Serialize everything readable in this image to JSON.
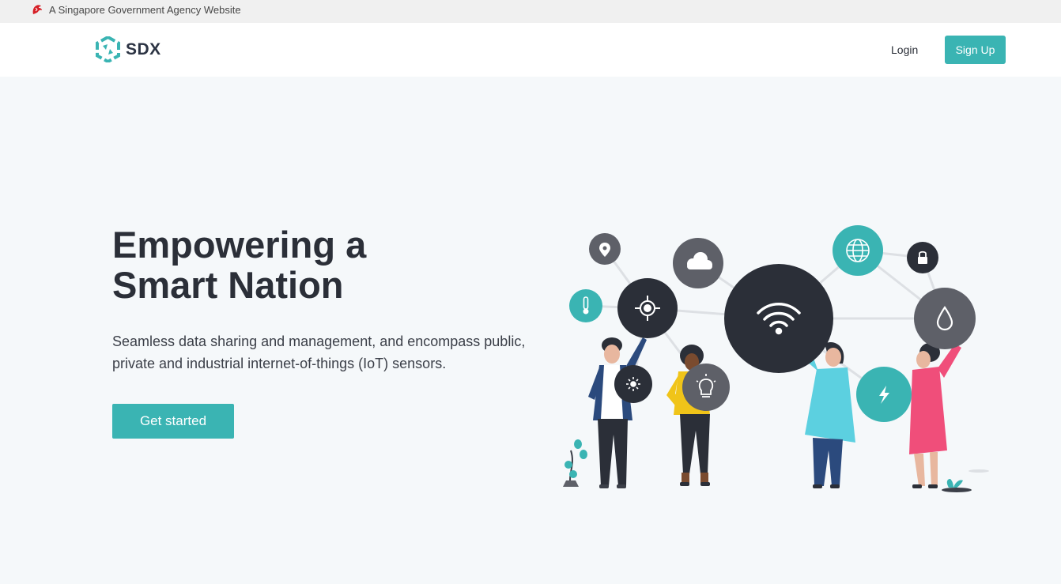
{
  "masthead": {
    "text": "A Singapore Government Agency Website",
    "icon": "lion-head-icon",
    "icon_color": "#d61f26"
  },
  "navbar": {
    "brand": "SDX",
    "login_label": "Login",
    "signup_label": "Sign Up"
  },
  "hero": {
    "title_line1": "Empowering a",
    "title_line2": "Smart Nation",
    "description": "Seamless data sharing and management, and encompass public, private and industrial internet-of-things (IoT) sensors.",
    "cta_label": "Get started"
  },
  "illustration": {
    "icons": [
      "map-pin-icon",
      "cloud-icon",
      "globe-icon",
      "lock-icon",
      "thermometer-icon",
      "crosshair-icon",
      "wifi-icon",
      "water-drop-icon",
      "light-icon",
      "lightbulb-icon",
      "lightning-icon"
    ]
  },
  "colors": {
    "accent": "#3ab4b3",
    "dark": "#2b2f38",
    "grey_node": "#5e6068",
    "background": "#f5f8fa"
  }
}
